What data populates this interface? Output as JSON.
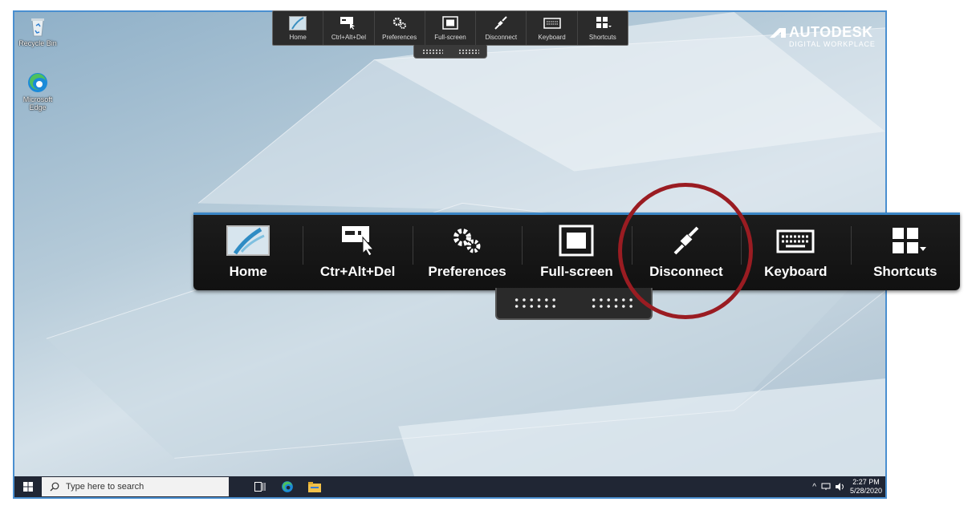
{
  "desktop": {
    "icons": [
      {
        "label": "Recycle Bin",
        "icon": "recycle-bin-icon"
      },
      {
        "label": "Microsoft Edge",
        "icon": "edge-icon"
      }
    ]
  },
  "logo": {
    "brand": "AUTODESK",
    "subtitle": "DIGITAL WORKPLACE"
  },
  "toolbar": {
    "buttons": [
      {
        "label": "Home",
        "icon": "home-thumbnail-icon"
      },
      {
        "label": "Ctrl+Alt+Del",
        "icon": "ctrl-alt-del-icon"
      },
      {
        "label": "Preferences",
        "icon": "gears-icon"
      },
      {
        "label": "Full-screen",
        "icon": "fullscreen-icon"
      },
      {
        "label": "Disconnect",
        "icon": "plug-icon"
      },
      {
        "label": "Keyboard",
        "icon": "keyboard-icon"
      },
      {
        "label": "Shortcuts",
        "icon": "grid-icon"
      }
    ]
  },
  "toolbar_zoomed": {
    "buttons": [
      {
        "label": "Home"
      },
      {
        "label": "Ctr+Alt+Del"
      },
      {
        "label": "Preferences"
      },
      {
        "label": "Full-screen"
      },
      {
        "label": "Disconnect"
      },
      {
        "label": "Keyboard"
      },
      {
        "label": "Shortcuts"
      }
    ],
    "highlighted": "Disconnect",
    "highlight_color": "#9a1c22",
    "accent_color": "#3b86c6"
  },
  "taskbar": {
    "search_placeholder": "Type here to search",
    "time": "2:27 PM",
    "date": "5/28/2020"
  }
}
